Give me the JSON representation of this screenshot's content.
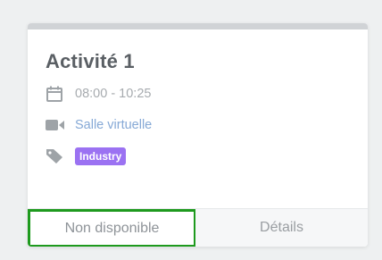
{
  "card": {
    "title": "Activité 1",
    "time": "08:00 - 10:25",
    "room_link": "Salle virtuelle",
    "tag": "Industry",
    "footer": {
      "unavailable_label": "Non disponible",
      "details_label": "Détails"
    }
  },
  "colors": {
    "tag_background": "#9b72f2",
    "link": "#86a9d6",
    "highlight_border": "#1e9a1e"
  },
  "icons": {
    "time": "calendar-icon",
    "room": "video-camera-icon",
    "tag": "tag-icon"
  }
}
